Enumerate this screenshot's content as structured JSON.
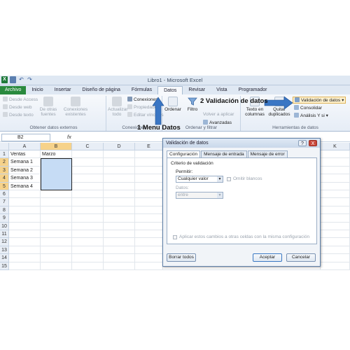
{
  "window": {
    "title": "Libro1 - Microsoft Excel"
  },
  "tabs": [
    "Archivo",
    "Inicio",
    "Insertar",
    "Diseño de página",
    "Fórmulas",
    "Datos",
    "Revisar",
    "Vista",
    "Programador"
  ],
  "ribbon": {
    "external_data": {
      "items": [
        "Desde Access",
        "Desde web",
        "Desde texto"
      ],
      "other_sources": "De otras fuentes",
      "existing": "Conexiones existentes",
      "label": "Obtener datos externos"
    },
    "connections": {
      "refresh": "Actualizar todo",
      "items": [
        "Conexiones",
        "Propiedades",
        "Editar vínculos"
      ],
      "label": "Conexiones"
    },
    "sort_filter": {
      "sort": "Ordenar",
      "filter": "Filtro",
      "reapply": "Volver a aplicar",
      "advanced": "Avanzadas",
      "label": "Ordenar y filtrar"
    },
    "data_tools": {
      "text_to_cols": "Texto en columnas",
      "remove_dup": "Quitar duplicados",
      "validation": "Validación de datos",
      "consolidate": "Consolidar",
      "whatif": "Análisis Y si",
      "label": "Herramientas de datos"
    }
  },
  "formula_bar": {
    "cell_ref": "B2",
    "fx": "fx"
  },
  "grid": {
    "columns": [
      "A",
      "B",
      "C",
      "D",
      "E",
      "K"
    ],
    "rows": [
      "1",
      "2",
      "3",
      "4",
      "5",
      "6",
      "7",
      "8",
      "9",
      "10",
      "11",
      "12",
      "13",
      "14",
      "15"
    ],
    "cells": {
      "A1": "Ventas",
      "B1": "Marzo",
      "A2": "Semana 1",
      "A3": "Semana 2",
      "A4": "Semana 3",
      "A5": "Semana 4"
    }
  },
  "dialog": {
    "title": "Validación de datos",
    "help": "?",
    "close": "X",
    "tabs": [
      "Configuración",
      "Mensaje de entrada",
      "Mensaje de error"
    ],
    "criteria_label": "Criterio de validación",
    "allow_label": "Permitir:",
    "allow_value": "Cualquier valor",
    "ignore_blank": "Omitir blancos",
    "data_label": "Datos:",
    "data_value": "entre",
    "apply_all": "Aplicar estos cambios a otras celdas con la misma configuración",
    "clear_all": "Borrar todos",
    "ok": "Aceptar",
    "cancel": "Cancelar"
  },
  "annotations": {
    "step1": "1 Menu Datos",
    "step2": "2 Validación de datos"
  },
  "colors": {
    "arrow": "#3a76c4",
    "file_tab": "#2a8a3e",
    "selection": "#c6dcf5",
    "header_sel": "#f6d28a"
  }
}
